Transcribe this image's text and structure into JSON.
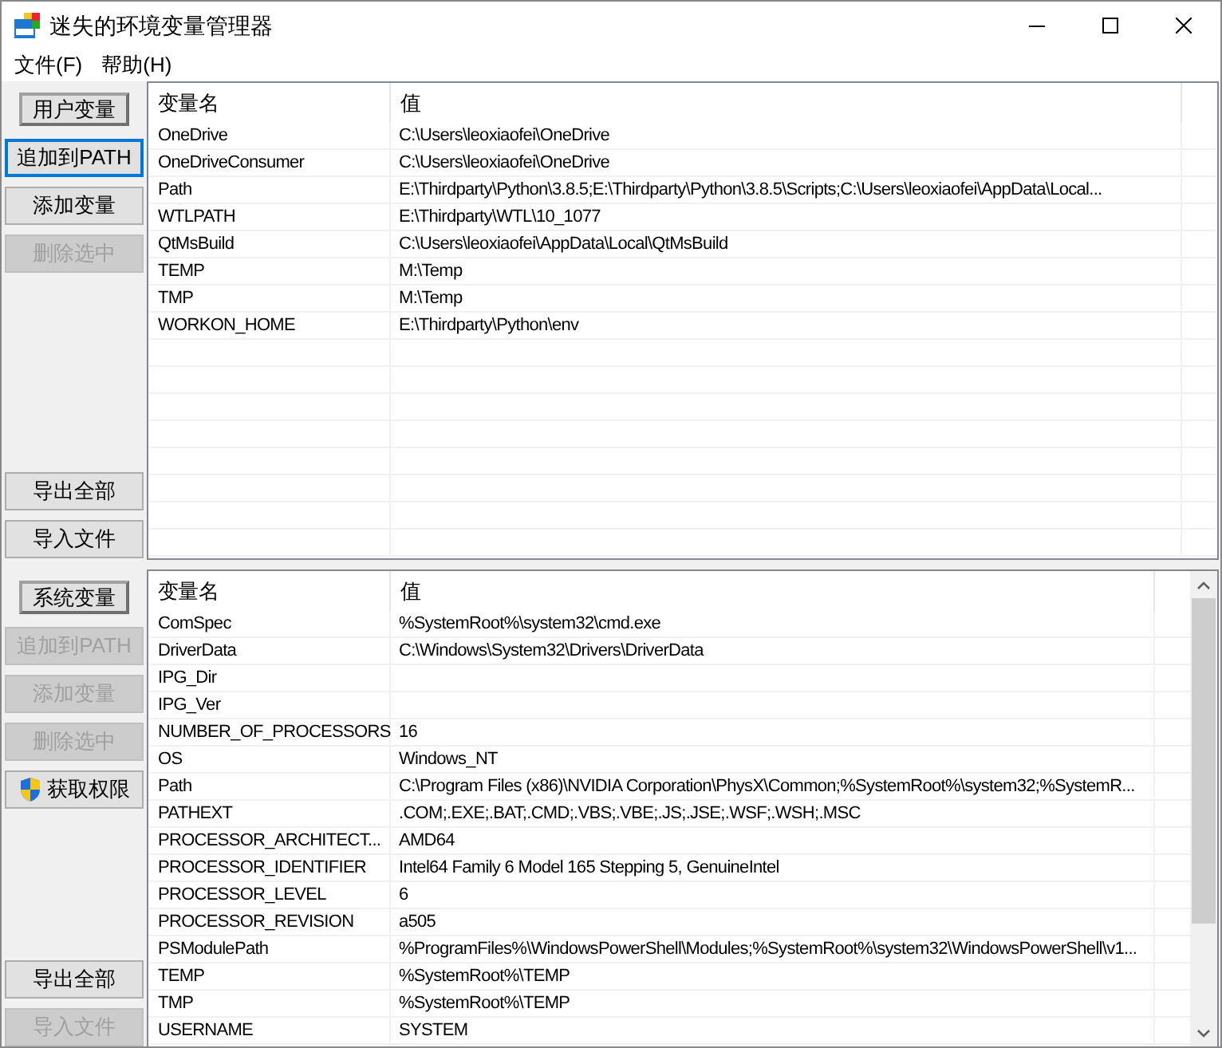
{
  "window": {
    "title": "迷失的环境变量管理器"
  },
  "menu": [
    {
      "label": "文件(F)"
    },
    {
      "label": "帮助(H)"
    }
  ],
  "panels": [
    {
      "toggle": {
        "label": "用户变量"
      },
      "buttons": [
        {
          "label": "追加到PATH",
          "disabled": false,
          "focused": true,
          "kind": "plain"
        },
        {
          "label": "添加变量",
          "disabled": false,
          "focused": false,
          "kind": "plain"
        },
        {
          "label": "删除选中",
          "disabled": true,
          "focused": false,
          "kind": "plain"
        }
      ],
      "bottom_buttons": [
        {
          "label": "导出全部",
          "disabled": false
        },
        {
          "label": "导入文件",
          "disabled": false
        }
      ],
      "table": {
        "columns": [
          "变量名",
          "值"
        ],
        "rows": [
          {
            "name": "OneDrive",
            "value": "C:\\Users\\leoxiaofei\\OneDrive"
          },
          {
            "name": "OneDriveConsumer",
            "value": "C:\\Users\\leoxiaofei\\OneDrive"
          },
          {
            "name": "Path",
            "value": "E:\\Thirdparty\\Python\\3.8.5;E:\\Thirdparty\\Python\\3.8.5\\Scripts;C:\\Users\\leoxiaofei\\AppData\\Local..."
          },
          {
            "name": "WTLPATH",
            "value": "E:\\Thirdparty\\WTL\\10_1077"
          },
          {
            "name": "QtMsBuild",
            "value": "C:\\Users\\leoxiaofei\\AppData\\Local\\QtMsBuild"
          },
          {
            "name": "TEMP",
            "value": "M:\\Temp"
          },
          {
            "name": "TMP",
            "value": "M:\\Temp"
          },
          {
            "name": "WORKON_HOME",
            "value": "E:\\Thirdparty\\Python\\env"
          }
        ]
      }
    },
    {
      "toggle": {
        "label": "系统变量"
      },
      "buttons": [
        {
          "label": "追加到PATH",
          "disabled": true,
          "focused": false,
          "kind": "plain"
        },
        {
          "label": "添加变量",
          "disabled": true,
          "focused": false,
          "kind": "plain"
        },
        {
          "label": "删除选中",
          "disabled": true,
          "focused": false,
          "kind": "plain"
        },
        {
          "label": "获取权限",
          "disabled": false,
          "focused": false,
          "kind": "shield"
        }
      ],
      "bottom_buttons": [
        {
          "label": "导出全部",
          "disabled": false
        },
        {
          "label": "导入文件",
          "disabled": true
        }
      ],
      "table": {
        "columns": [
          "变量名",
          "值"
        ],
        "rows": [
          {
            "name": "ComSpec",
            "value": "%SystemRoot%\\system32\\cmd.exe"
          },
          {
            "name": "DriverData",
            "value": "C:\\Windows\\System32\\Drivers\\DriverData"
          },
          {
            "name": "IPG_Dir",
            "value": ""
          },
          {
            "name": "IPG_Ver",
            "value": ""
          },
          {
            "name": "NUMBER_OF_PROCESSORS",
            "value": "16"
          },
          {
            "name": "OS",
            "value": "Windows_NT"
          },
          {
            "name": "Path",
            "value": "C:\\Program Files (x86)\\NVIDIA Corporation\\PhysX\\Common;%SystemRoot%\\system32;%SystemR..."
          },
          {
            "name": "PATHEXT",
            "value": ".COM;.EXE;.BAT;.CMD;.VBS;.VBE;.JS;.JSE;.WSF;.WSH;.MSC"
          },
          {
            "name": "PROCESSOR_ARCHITECT...",
            "value": "AMD64"
          },
          {
            "name": "PROCESSOR_IDENTIFIER",
            "value": "Intel64 Family 6 Model 165 Stepping 5, GenuineIntel"
          },
          {
            "name": "PROCESSOR_LEVEL",
            "value": "6"
          },
          {
            "name": "PROCESSOR_REVISION",
            "value": "a505"
          },
          {
            "name": "PSModulePath",
            "value": "%ProgramFiles%\\WindowsPowerShell\\Modules;%SystemRoot%\\system32\\WindowsPowerShell\\v1..."
          },
          {
            "name": "TEMP",
            "value": "%SystemRoot%\\TEMP"
          },
          {
            "name": "TMP",
            "value": "%SystemRoot%\\TEMP"
          },
          {
            "name": "USERNAME",
            "value": "SYSTEM"
          }
        ]
      }
    }
  ]
}
